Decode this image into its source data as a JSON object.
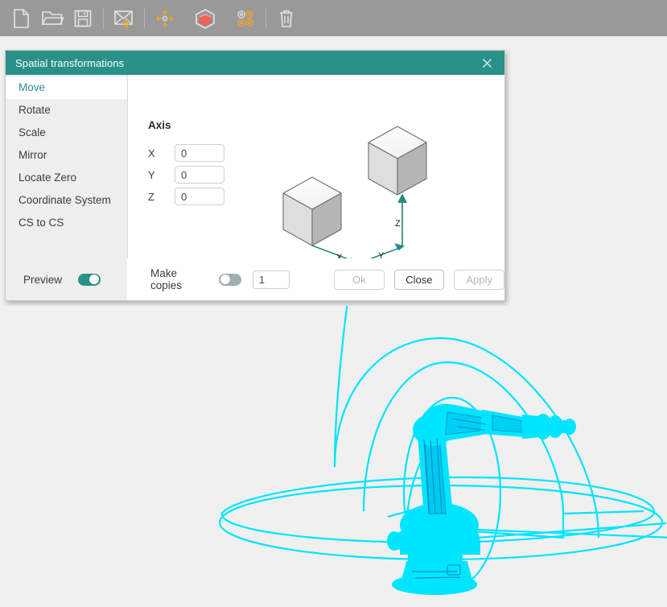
{
  "toolbar": {
    "items": [
      {
        "name": "new-file-icon",
        "label": "New"
      },
      {
        "name": "open-folder-icon",
        "label": "Open"
      },
      {
        "name": "save-icon",
        "label": "Save"
      },
      {
        "name": "export-icon",
        "label": "Export"
      },
      {
        "name": "move-tool-icon",
        "label": "Move"
      },
      {
        "name": "cube-icon",
        "label": "Solid"
      },
      {
        "name": "array-pattern-icon",
        "label": "Array"
      },
      {
        "name": "delete-trash-icon",
        "label": "Delete"
      }
    ]
  },
  "dialog": {
    "title": "Spatial transformations",
    "close_label": "✕",
    "sidebar": {
      "items": [
        {
          "label": "Move",
          "active": true
        },
        {
          "label": "Rotate",
          "active": false
        },
        {
          "label": "Scale",
          "active": false
        },
        {
          "label": "Mirror",
          "active": false
        },
        {
          "label": "Locate Zero",
          "active": false
        },
        {
          "label": "Coordinate System",
          "active": false
        },
        {
          "label": "CS to CS",
          "active": false
        }
      ],
      "preview_label": "Preview",
      "preview_on": true
    },
    "main": {
      "axis_title": "Axis",
      "fields": [
        {
          "label": "X",
          "value": "0"
        },
        {
          "label": "Y",
          "value": "0"
        },
        {
          "label": "Z",
          "value": "0"
        }
      ],
      "diagram": {
        "axis_x_label": "X",
        "axis_y_label": "Y",
        "axis_z_label": "Z"
      }
    },
    "footer": {
      "make_copies_label": "Make copies",
      "make_copies_on": false,
      "copies_count": "1",
      "ok_label": "Ok",
      "close_label": "Close",
      "apply_label": "Apply",
      "ok_enabled": false,
      "close_enabled": true,
      "apply_enabled": false
    }
  },
  "viewport": {
    "model_name": "industrial-robot-arm-wireframe",
    "wireframe_color": "#00E5FF",
    "background_color": "#f0f0f0"
  },
  "colors": {
    "accent_teal": "#2a9189",
    "toolbar_bg": "#999999",
    "sidebar_bg": "#eeeeee",
    "cyan": "#00E5FF",
    "orange": "#E8A33D",
    "red": "#E8645A"
  }
}
